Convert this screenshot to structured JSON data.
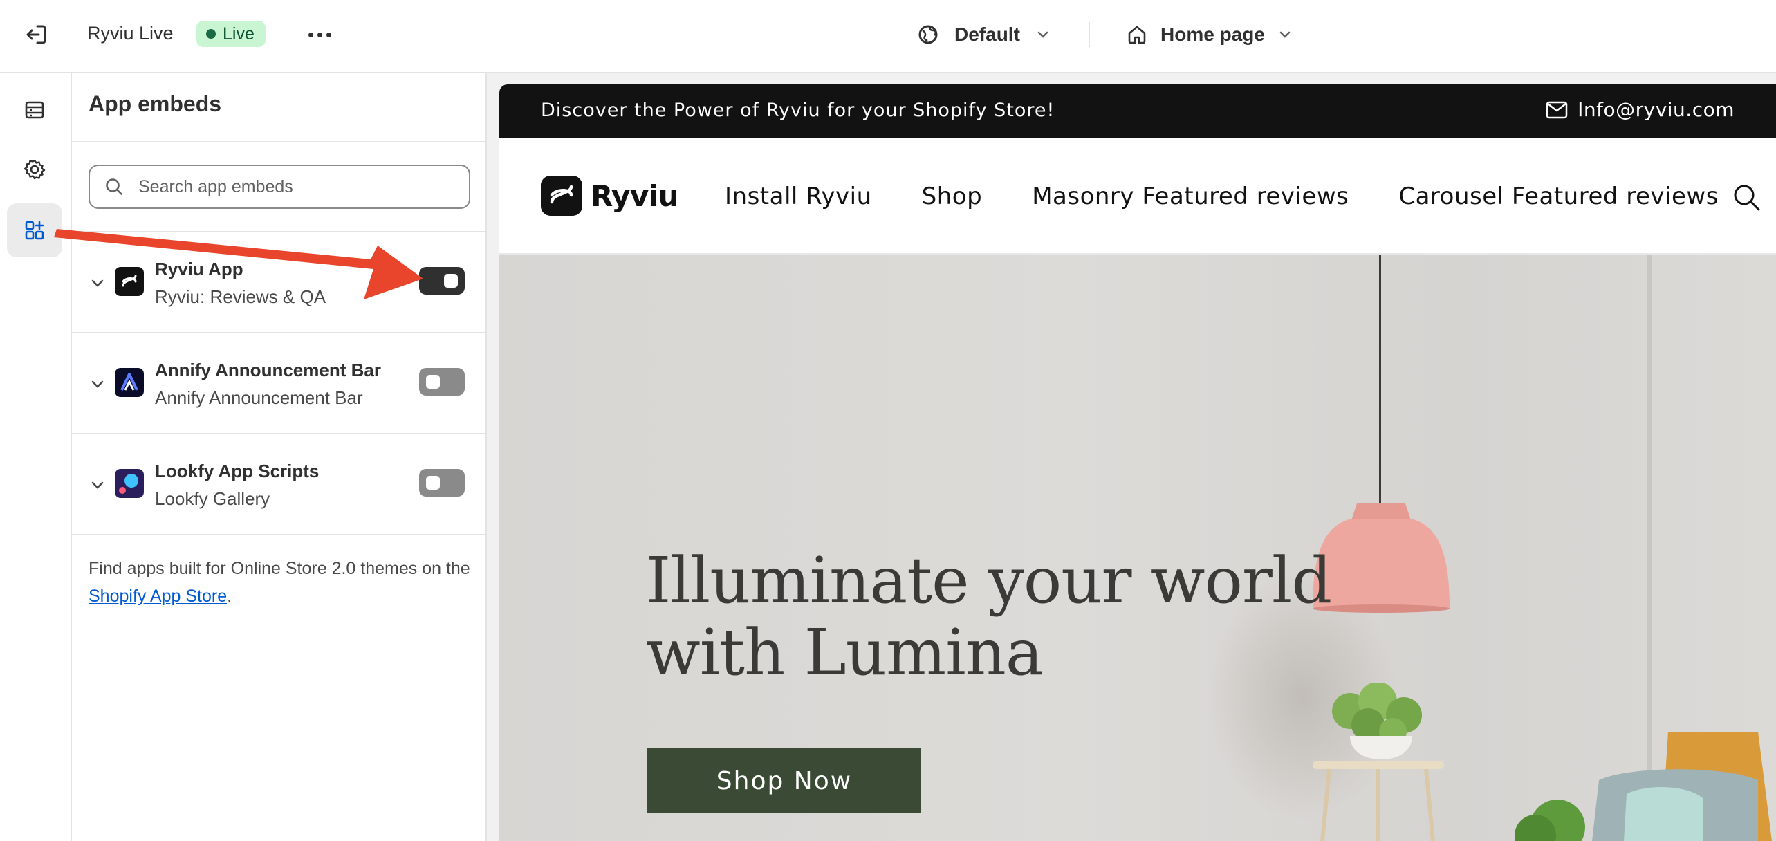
{
  "topbar": {
    "title": "Ryviu Live",
    "live_badge": "Live",
    "theme_label": "Default",
    "page_label": "Home page"
  },
  "panel": {
    "title": "App embeds",
    "search_placeholder": "Search app embeds",
    "embeds": [
      {
        "name": "Ryviu App",
        "subtitle": "Ryviu: Reviews & QA",
        "enabled": true,
        "icon": "ryviu-app-icon"
      },
      {
        "name": "Annify Announcement Bar",
        "subtitle": "Annify Announcement Bar",
        "enabled": false,
        "icon": "annify-app-icon"
      },
      {
        "name": "Lookfy App Scripts",
        "subtitle": "Lookfy Gallery",
        "enabled": false,
        "icon": "lookfy-app-icon"
      }
    ],
    "footer_prefix": "Find apps built for Online Store 2.0 themes on the ",
    "footer_link": "Shopify App Store",
    "footer_suffix": "."
  },
  "preview": {
    "announcement": "Discover the Power of Ryviu for your Shopify Store!",
    "email": "Info@ryviu.com",
    "logo_text": "Ryviu",
    "nav": [
      "Install Ryviu",
      "Shop",
      "Masonry Featured reviews",
      "Carousel Featured reviews"
    ],
    "hero_line1": "Illuminate your world",
    "hero_line2": "with Lumina",
    "cta": "Shop Now"
  },
  "colors": {
    "toggle_on": "#303030",
    "toggle_off": "#8a8a8a",
    "live_badge_bg": "#c9f5d2",
    "annotation_arrow": "#e8452c",
    "cta_bg": "#3a4a34",
    "announcement_bg": "#121212"
  }
}
